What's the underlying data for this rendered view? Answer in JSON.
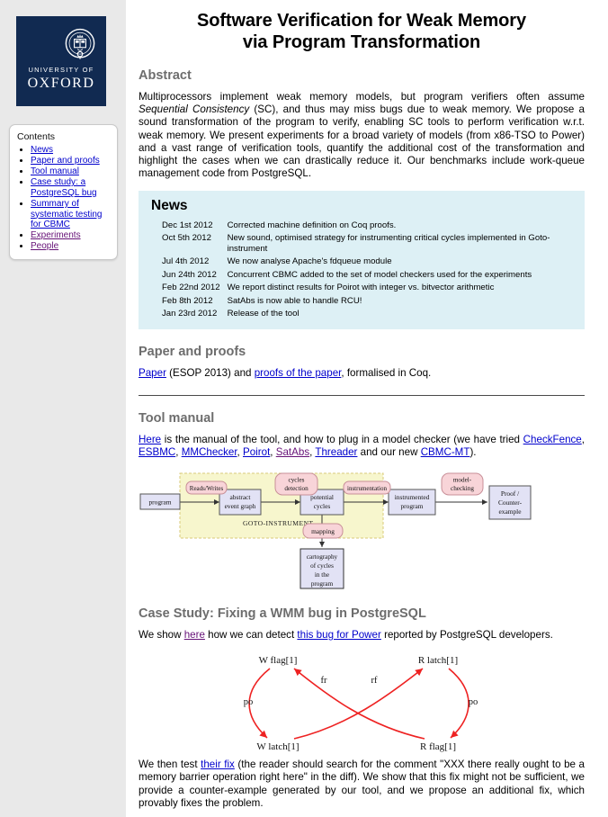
{
  "sidebar": {
    "logo": {
      "icon": "oxford-crest-icon",
      "line1": "UNIVERSITY OF",
      "line2": "OXFORD"
    },
    "contents_title": "Contents",
    "items": [
      {
        "label": "News",
        "visited": false
      },
      {
        "label": "Paper and proofs",
        "visited": false
      },
      {
        "label": "Tool manual",
        "visited": false
      },
      {
        "label": "Case study: a PostgreSQL bug",
        "visited": false
      },
      {
        "label": "Summary of systematic testing for CBMC",
        "visited": false
      },
      {
        "label": "Experiments",
        "visited": true
      },
      {
        "label": "People",
        "visited": true
      }
    ]
  },
  "header": {
    "title_line1": "Software Verification for Weak Memory",
    "title_line2": "via Program Transformation"
  },
  "abstract": {
    "heading": "Abstract",
    "part1": "Multiprocessors implement weak memory models, but program verifiers often assume ",
    "emphasis": "Sequential Consistency",
    "part2": " (SC), and thus may miss bugs due to weak memory. We propose a sound transformation of the program to verify, enabling SC tools to perform verification w.r.t. weak memory. We present experiments for a broad variety of models (from x86-TSO to Power) and a vast range of verification tools, quantify the additional cost of the transformation and highlight the cases when we can drastically reduce it. Our benchmarks include work-queue management code from PostgreSQL."
  },
  "news": {
    "heading": "News",
    "entries": [
      {
        "date": "Dec 1st 2012",
        "text": "Corrected machine definition on Coq proofs."
      },
      {
        "date": "Oct 5th 2012",
        "text": "New sound, optimised strategy for instrumenting critical cycles implemented in Goto-instrument"
      },
      {
        "date": "Jul 4th 2012",
        "text": "We now analyse Apache's fdqueue module"
      },
      {
        "date": "Jun 24th 2012",
        "text": "Concurrent CBMC added to the set of model checkers used for the experiments"
      },
      {
        "date": "Feb 22nd 2012",
        "text": "We report distinct results for Poirot with integer vs. bitvector arithmetic"
      },
      {
        "date": "Feb 8th 2012",
        "text": "SatAbs is now able to handle RCU!"
      },
      {
        "date": "Jan 23rd 2012",
        "text": "Release of the tool"
      }
    ]
  },
  "paper_section": {
    "heading": "Paper and proofs",
    "link_paper": "Paper",
    "mid": " (ESOP 2013) and ",
    "link_proofs": "proofs of the paper",
    "tail": ", formalised in Coq."
  },
  "tool_section": {
    "heading": "Tool manual",
    "link_here": "Here",
    "text1": " is the manual of the tool, and how to plug in a model checker (we have tried ",
    "tools": [
      {
        "label": "CheckFence",
        "visited": false
      },
      {
        "label": "ESBMC",
        "visited": false
      },
      {
        "label": "MMChecker",
        "visited": false
      },
      {
        "label": "Poirot",
        "visited": false
      },
      {
        "label": "SatAbs",
        "visited": true
      },
      {
        "label": "Threader",
        "visited": false
      }
    ],
    "text2": " and our new ",
    "link_cbmcmt": "CBMC-MT",
    "text3": ")."
  },
  "pipeline_diagram": {
    "name": "goto-instrument-pipeline",
    "group_label": "GOTO-INSTRUMENT",
    "boxes": [
      {
        "id": "program",
        "label": "program",
        "kind": "blue"
      },
      {
        "id": "abstract-event-graph",
        "label": "abstract\nevent graph",
        "kind": "blue"
      },
      {
        "id": "potential-cycles",
        "label": "potential\ncycles",
        "kind": "blue"
      },
      {
        "id": "instrumented-program",
        "label": "instrumented\nprogram",
        "kind": "blue"
      },
      {
        "id": "proof-counterexample",
        "label": "Proof /\nCounter-\nexample",
        "kind": "blue"
      },
      {
        "id": "cartography",
        "label": "cartography\nof cycles\nin the\nprogram",
        "kind": "blue"
      }
    ],
    "pills": [
      {
        "id": "reads-writes",
        "label": "Reads/Writes"
      },
      {
        "id": "cycles-detection",
        "label": "cycles\ndetection"
      },
      {
        "id": "instrumentation",
        "label": "instrumentation"
      },
      {
        "id": "mapping",
        "label": "mapping"
      },
      {
        "id": "model-checking",
        "label": "model-\nchecking"
      }
    ]
  },
  "case_study": {
    "heading": "Case Study: Fixing a WMM bug in PostgreSQL",
    "text1": "We show ",
    "link_here": "here",
    "text2": " how we can detect ",
    "link_bug": "this bug for Power",
    "text3": " reported by PostgreSQL developers."
  },
  "exec_diagram": {
    "name": "weak-memory-execution-cycle",
    "nodes": [
      {
        "id": "w-flag",
        "label": "W flag[1]"
      },
      {
        "id": "r-latch",
        "label": "R latch[1]"
      },
      {
        "id": "w-latch",
        "label": "W latch[1]"
      },
      {
        "id": "r-flag",
        "label": "R flag[1]"
      }
    ],
    "edges": [
      {
        "id": "po-left",
        "label": "po"
      },
      {
        "id": "po-right",
        "label": "po"
      },
      {
        "id": "fr",
        "label": "fr"
      },
      {
        "id": "rf",
        "label": "rf"
      }
    ],
    "edge_color": "#ee2222"
  },
  "closing": {
    "text1": "We then test ",
    "link_fix": "their fix",
    "text2": " (the reader should search for the comment \"XXX there really ought to be a memory barrier operation right here\" in the diff). We show that this fix might not be sufficient, we provide a counter-example generated by our tool, and we propose an additional fix, which provably fixes the problem."
  },
  "colors": {
    "link": "#0000cc",
    "visited_link": "#661177",
    "news_bg": "#ddf0f5",
    "sidebar_bg": "#e9e9e9",
    "heading_gray": "#6d6d6d",
    "oxford_navy": "#112a51",
    "diagram_blue_box": "#e2e2f5",
    "diagram_pink_pill": "#f8d4d8",
    "diagram_group_bg": "#f7f6cd"
  }
}
